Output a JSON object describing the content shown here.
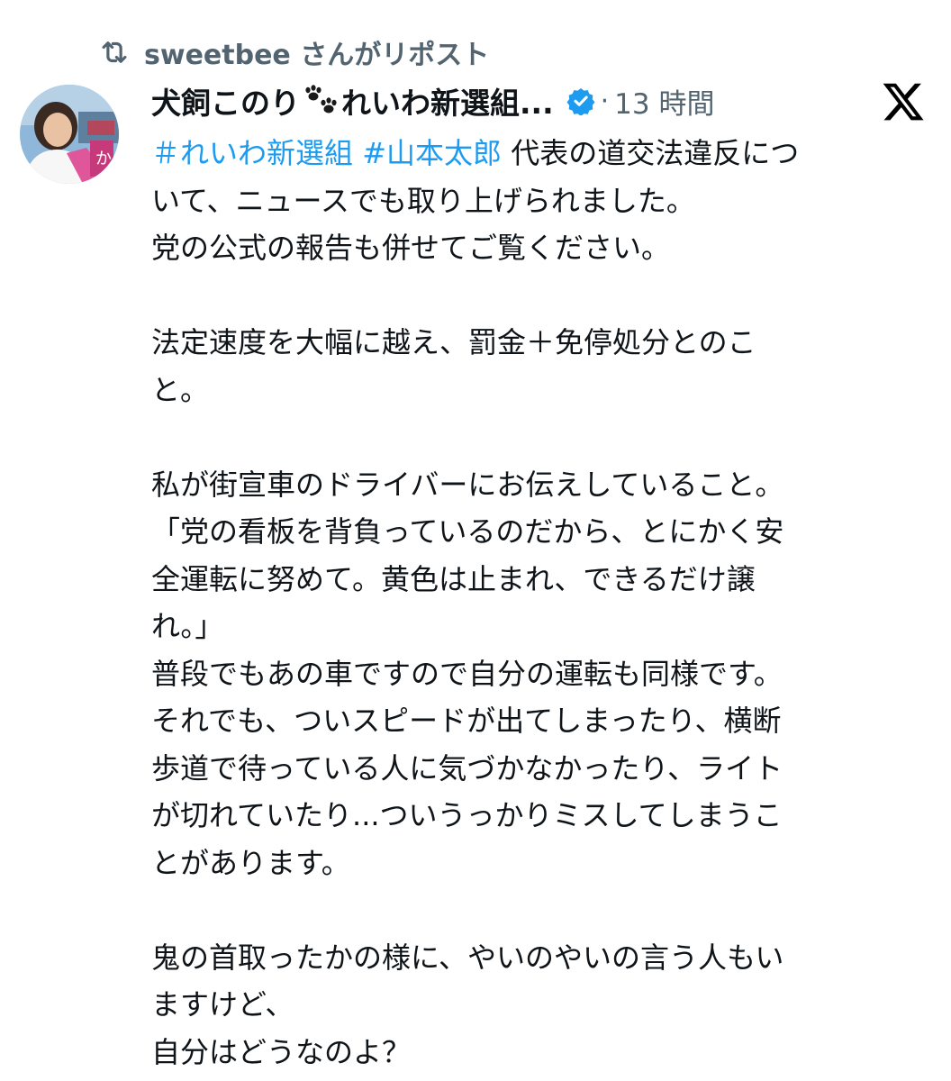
{
  "repost": {
    "icon": "repost-icon",
    "text": "sweetbee さんがリポスト"
  },
  "tweet": {
    "avatar": "profile-photo",
    "display_name": "犬飼このり",
    "name_emoji": "paw-prints-icon",
    "name_suffix": "れいわ新選組...",
    "verified_icon": "verified-badge-icon",
    "separator": "·",
    "timestamp": "13 時間",
    "brand_icon": "x-logo-icon",
    "hashtag1": "＃れいわ新選組",
    "hashtag2": "#山本太郎",
    "lines": [
      "代表の道交法違反につ",
      "いて、ニュースでも取り上げられました。",
      "党の公式の報告も併せてご覧ください。",
      "",
      "法定速度を大幅に越え、罰金＋免停処分とのこ",
      "と。",
      "",
      "私が街宣車のドライバーにお伝えしていること。",
      "「党の看板を背負っているのだから、とにかく安",
      "全運転に努めて。黄色は止まれ、できるだけ譲",
      "れ。」",
      "普段でもあの車ですので自分の運転も同様です。",
      "それでも、ついスピードが出てしまったり、横断",
      "歩道で待っている人に気づかなかったり、ライト",
      "が切れていたり...ついうっかりミスしてしまうこ",
      "とがあります。",
      "",
      "鬼の首取ったかの様に、やいのやいの言う人もい",
      "ますけど、",
      "自分はどうなのよ？"
    ]
  },
  "colors": {
    "link": "#1d9bf0",
    "secondary_text": "#536471",
    "primary_text": "#0f1419",
    "verified": "#1d9bf0"
  }
}
